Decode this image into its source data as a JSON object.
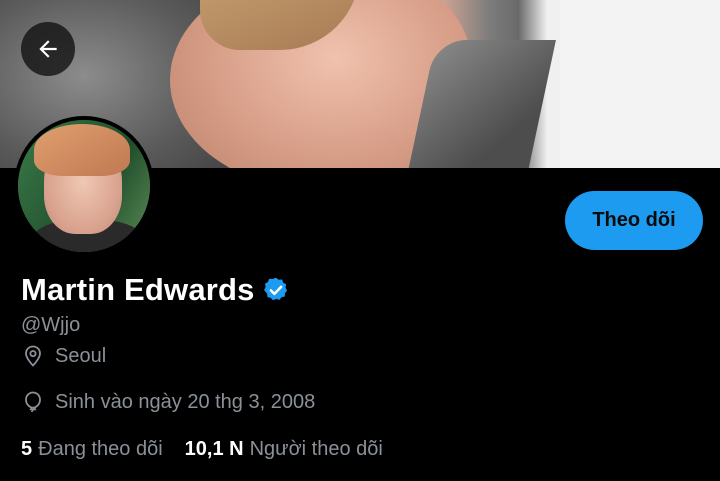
{
  "header": {
    "back_icon": "arrow-left-icon"
  },
  "profile": {
    "name": "Martin Edwards",
    "verified_icon": "verified-badge-icon",
    "handle": "@Wjjo",
    "location": "Seoul",
    "location_icon": "location-pin-icon",
    "birthday": "Sinh vào ngày 20 thg 3, 2008",
    "birthday_icon": "balloon-icon"
  },
  "actions": {
    "follow_label": "Theo dõi"
  },
  "stats": {
    "following_count": "5",
    "following_label": "Đang theo dõi",
    "followers_count": "10,1 N",
    "followers_label": "Người theo dõi"
  },
  "colors": {
    "accent": "#1d9bf0",
    "background": "#000000",
    "muted_text": "#8b9198"
  }
}
